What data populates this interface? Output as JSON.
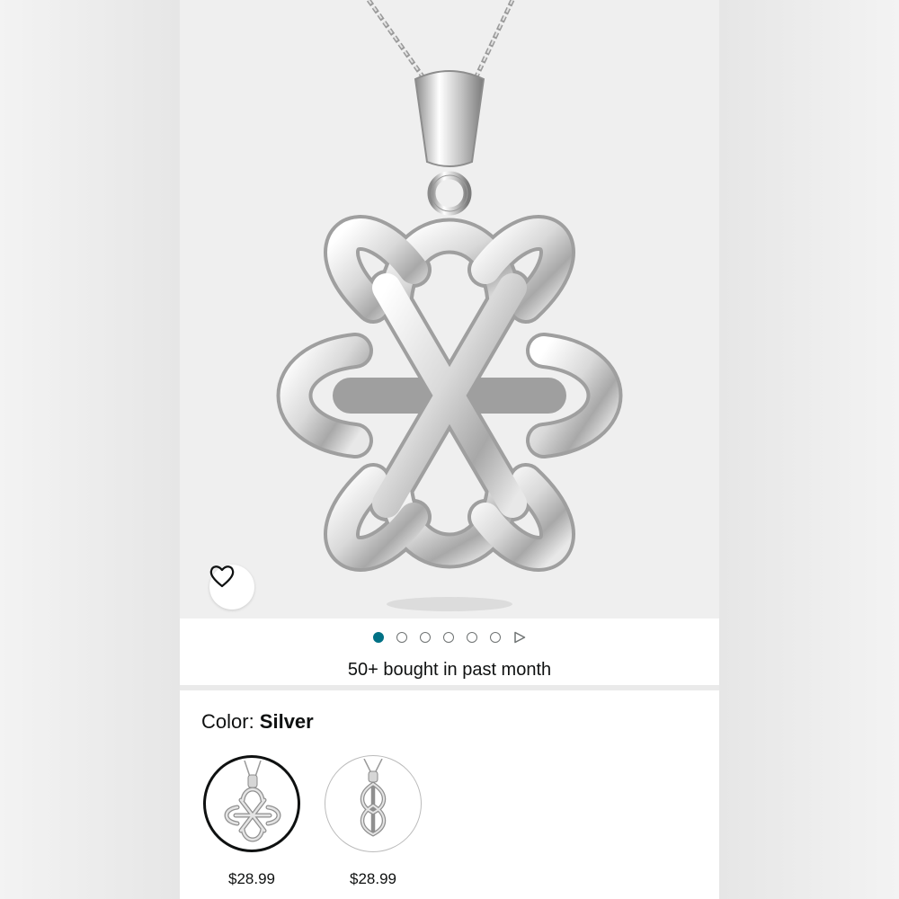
{
  "product": {
    "image_alt": "Silver celtic knot pendant necklace",
    "wishlist_icon": "heart-outline-icon"
  },
  "carousel": {
    "total_dots": 6,
    "active_index": 0,
    "has_video": true,
    "bought_text": "50+ bought in past month"
  },
  "variants": {
    "color_label": "Color: ",
    "color_value": "Silver",
    "options": [
      {
        "price": "$28.99",
        "selected": true
      },
      {
        "price": "$28.99",
        "selected": false
      }
    ]
  },
  "colors": {
    "active_dot": "#007185",
    "text": "#0f1111"
  }
}
